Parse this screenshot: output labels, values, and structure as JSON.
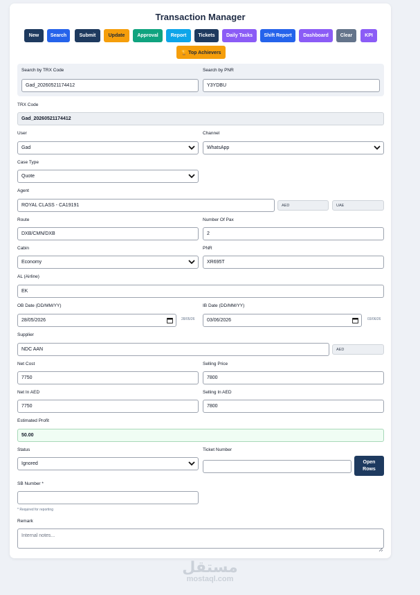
{
  "app": {
    "title": "Transaction Manager"
  },
  "toolbar": {
    "new": "New",
    "search": "Search",
    "submit": "Submit",
    "update": "Update",
    "approval": "Approval",
    "report": "Report",
    "tickets": "Tickets",
    "daily_tasks": "Daily Tasks",
    "shift_report": "Shift Report",
    "dashboard": "Dashboard",
    "clear": "Clear",
    "kpi": "KPI",
    "top_achievers": "🏆 Top Achievers"
  },
  "search": {
    "trx_label": "Search by TRX Code",
    "trx_value": "Gad_20260521174412",
    "pnr_label": "Search by PNR",
    "pnr_value": "Y3YDBU"
  },
  "form": {
    "trx_code": {
      "label": "TRX Code",
      "value": "Gad_20260521174412"
    },
    "user": {
      "label": "User",
      "value": "Gad"
    },
    "channel": {
      "label": "Channel",
      "value": "WhatsApp"
    },
    "case_type": {
      "label": "Case Type",
      "value": "Quote"
    },
    "agent": {
      "label": "Agent",
      "value": "ROYAL CLASS - CA19191",
      "currency": "AED",
      "country": "UAE"
    },
    "route": {
      "label": "Route",
      "value": "DXB/CMN/DXB"
    },
    "pax": {
      "label": "Number Of Pax",
      "value": "2"
    },
    "cabin": {
      "label": "Cabin",
      "value": "Economy"
    },
    "pnr": {
      "label": "PNR",
      "value": "XR695T"
    },
    "airline": {
      "label": "AL (Airline)",
      "value": "EK"
    },
    "ob_date": {
      "label": "OB Date (DD/MM/YY)",
      "value": "28/05/2026",
      "side": "28/05/26"
    },
    "ib_date": {
      "label": "IB Date (DD/MM/YY)",
      "value": "03/06/2026",
      "side": "03/06/26"
    },
    "supplier": {
      "label": "Supplier",
      "value": "NDC AAN",
      "currency": "AED"
    },
    "net_cost": {
      "label": "Net Cost",
      "value": "7750"
    },
    "selling_price": {
      "label": "Selling Price",
      "value": "7800"
    },
    "net_aed": {
      "label": "Net In AED",
      "value": "7750"
    },
    "selling_aed": {
      "label": "Selling In AED",
      "value": "7800"
    },
    "profit": {
      "label": "Estimated Profit",
      "value": "50.00"
    },
    "status": {
      "label": "Status",
      "value": "Ignored"
    },
    "ticket_number": {
      "label": "Ticket Number",
      "value": ""
    },
    "open_rows": "Open Rows",
    "sb_number": {
      "label": "SB Number *",
      "value": "",
      "hint": "* Required for reporting"
    },
    "remark": {
      "label": "Remark",
      "placeholder": "Internal notes..."
    }
  },
  "watermark": {
    "arabic": "مستقل",
    "latin": "mostaql.com"
  },
  "colors": {
    "navy": "#1e3a5f",
    "blue": "#2563eb",
    "amber": "#f59e0b",
    "green": "#10a37f",
    "sky": "#0ea5e9",
    "purple": "#8b5cf6",
    "slate": "#64748b",
    "profit_bg": "#f0fdf4"
  }
}
